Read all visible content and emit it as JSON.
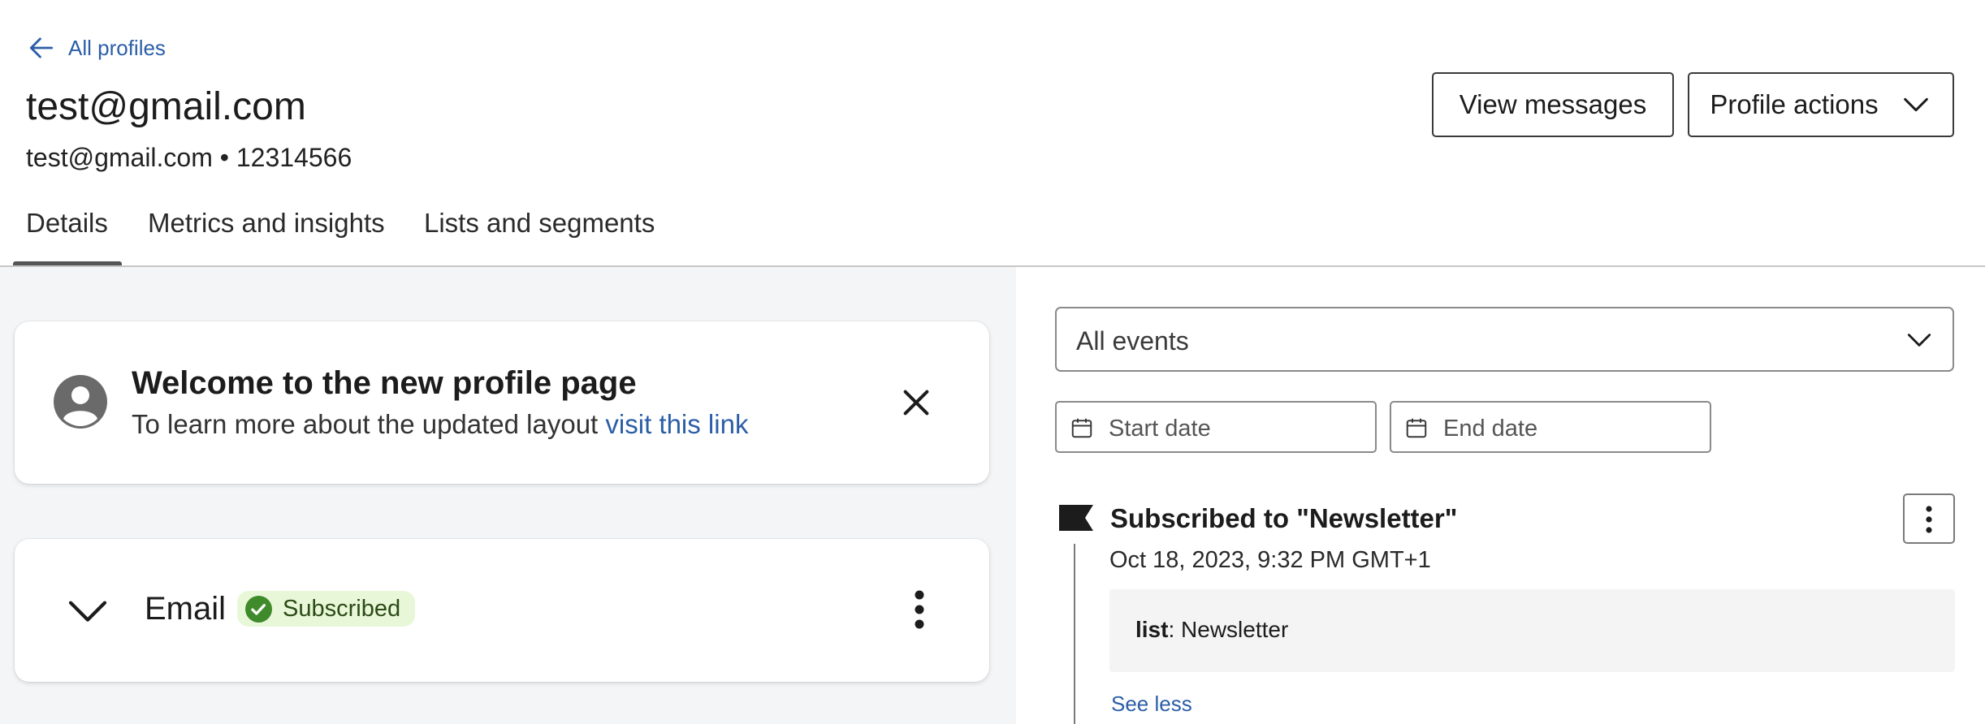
{
  "header": {
    "back_label": "All profiles",
    "title": "test@gmail.com",
    "subtitle": "test@gmail.com • 12314566",
    "view_messages_label": "View messages",
    "profile_actions_label": "Profile actions"
  },
  "tabs": [
    {
      "label": "Details",
      "active": true
    },
    {
      "label": "Metrics and insights",
      "active": false
    },
    {
      "label": "Lists and segments",
      "active": false
    }
  ],
  "welcome_card": {
    "title": "Welcome to the new profile page",
    "text": "To learn more about the updated layout ",
    "link": "visit this link"
  },
  "email_card": {
    "label": "Email",
    "badge": "Subscribed"
  },
  "filters": {
    "event_select": "All events",
    "start_date_placeholder": "Start date",
    "end_date_placeholder": "End date"
  },
  "event": {
    "title": "Subscribed to \"Newsletter\"",
    "date": "Oct 18, 2023, 9:32 PM GMT+1",
    "detail_key": "list",
    "detail_value": ": Newsletter",
    "see_less": "See less"
  },
  "colors": {
    "link": "#2b5ea7",
    "badge_bg": "#e9f7d9",
    "badge_icon": "#3f8a2a",
    "panel_bg": "#f4f5f7"
  },
  "icons": [
    "arrow-left-icon",
    "chevron-down-icon",
    "user-circle-icon",
    "close-icon",
    "check-circle-icon",
    "kebab-icon",
    "calendar-icon",
    "flag-icon"
  ]
}
